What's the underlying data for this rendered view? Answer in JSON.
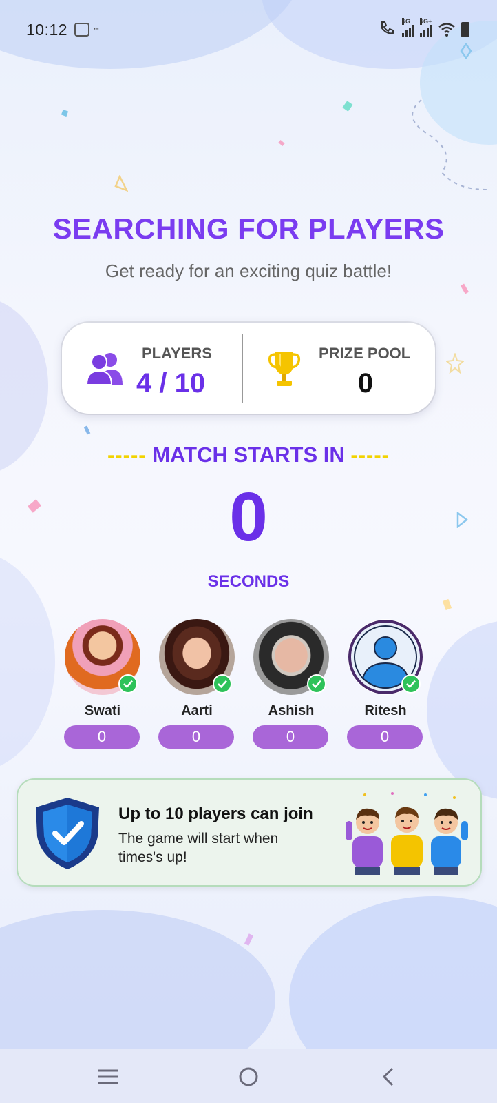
{
  "status_bar": {
    "time": "10:12",
    "signal_1_label": "5G",
    "signal_2_label": "5G+"
  },
  "header": {
    "title": "SEARCHING FOR PLAYERS",
    "subtitle": "Get ready for an exciting quiz battle!"
  },
  "stats": {
    "players_label": "PLAYERS",
    "players_value": "4 / 10",
    "prize_label": "PRIZE POOL",
    "prize_value": "0"
  },
  "match": {
    "dash_left": "-----",
    "label": "MATCH STARTS IN",
    "dash_right": "-----",
    "countdown": "0",
    "unit": "SECONDS"
  },
  "players": [
    {
      "name": "Swati",
      "score": "0"
    },
    {
      "name": "Aarti",
      "score": "0"
    },
    {
      "name": "Ashish",
      "score": "0"
    },
    {
      "name": "Ritesh",
      "score": "0"
    }
  ],
  "info": {
    "title": "Up to 10 players can join",
    "description": "The game will start when times's up!"
  },
  "colors": {
    "accent": "#6a30e8",
    "title": "#7a3cf0",
    "score_pill": "#a966d8",
    "check": "#2ec25a",
    "dash": "#f2d300"
  },
  "icons": {
    "players": "players-group-icon",
    "prize": "trophy-icon",
    "info": "shield-check-icon",
    "nav_menu": "menu-icon",
    "nav_home": "home-circle-icon",
    "nav_back": "back-chevron-icon"
  }
}
